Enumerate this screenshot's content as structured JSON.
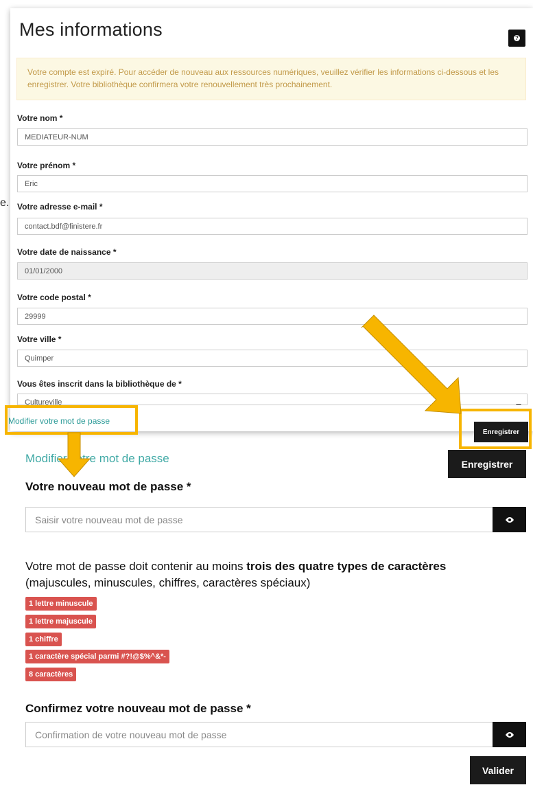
{
  "top_form": {
    "title": "Mes informations",
    "help_label": "?",
    "alert": "Votre compte est expiré. Pour accéder de nouveau aux ressources numériques, veuillez vérifier les informations ci-dessous et les enregistrer. Votre bibliothèque confirmera votre renouvellement très prochainement.",
    "fields": [
      {
        "label": "Votre nom *",
        "value": "MEDIATEUR-NUM"
      },
      {
        "label": "Votre prénom *",
        "value": "Eric"
      },
      {
        "label": "Votre adresse e-mail *",
        "value": "contact.bdf@finistere.fr"
      },
      {
        "label": "Votre date de naissance *",
        "value": "01/01/2000"
      },
      {
        "label": "Votre code postal *",
        "value": "29999"
      },
      {
        "label": "Votre ville *",
        "value": "Quimper"
      },
      {
        "label": "Vous êtes inscrit dans la bibliothèque de *",
        "value": "Cultureville"
      }
    ],
    "modify_link": "Modifier votre mot de passe",
    "save_label": "Enregistrer",
    "stray_text": "e."
  },
  "password_form": {
    "title": "Modifier votre mot de passe",
    "save_label": "Enregistrer",
    "new_label": "Votre nouveau mot de passe *",
    "new_placeholder": "Saisir votre nouveau mot de passe",
    "rules_intro": "Votre mot de passe doit contenir au moins ",
    "rules_bold": "trois des quatre types de caractères",
    "rules_detail": "(majuscules, minuscules, chiffres, caractères spéciaux)",
    "badges": [
      "1 lettre minuscule",
      "1 lettre majuscule",
      "1 chiffre",
      "1 caractère spécial parmi #?!@$%^&*-",
      "8 caractères"
    ],
    "confirm_label": "Confirmez votre nouveau mot de passe *",
    "confirm_placeholder": "Confirmation de votre nouveau mot de passe",
    "validate_label": "Valider"
  },
  "colors": {
    "highlight": "#f7b500",
    "accent_teal": "#3fa9a5",
    "badge_red": "#d9534f",
    "alert_bg": "#fcf8e3"
  },
  "icons": [
    "help-icon",
    "eye-icon",
    "caret-down-icon",
    "arrow-icon"
  ]
}
